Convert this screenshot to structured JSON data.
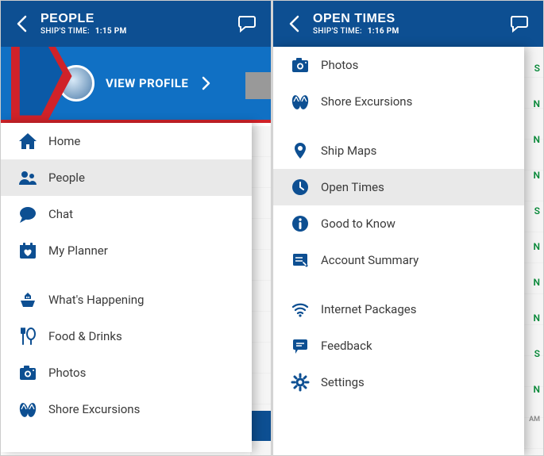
{
  "colors": {
    "brand_blue": "#0d4f92",
    "accent_red": "#d02229",
    "bg_selected": "#e9e9e9"
  },
  "left": {
    "header": {
      "title": "PEOPLE",
      "time_label": "SHIP'S TIME:",
      "time": "1:15 PM"
    },
    "profile": {
      "label": "VIEW PROFILE"
    },
    "menu": [
      {
        "key": "home",
        "label": "Home",
        "icon": "home-icon"
      },
      {
        "key": "people",
        "label": "People",
        "icon": "people-icon",
        "selected": true
      },
      {
        "key": "chat",
        "label": "Chat",
        "icon": "chat-bubble-icon"
      },
      {
        "key": "planner",
        "label": "My Planner",
        "icon": "calendar-heart-icon"
      },
      {
        "sep": true
      },
      {
        "key": "happening",
        "label": "What's Happening",
        "icon": "ship-icon"
      },
      {
        "key": "food",
        "label": "Food & Drinks",
        "icon": "food-icon"
      },
      {
        "key": "photos",
        "label": "Photos",
        "icon": "camera-icon"
      },
      {
        "key": "shore",
        "label": "Shore Excursions",
        "icon": "flipflops-icon"
      }
    ]
  },
  "right": {
    "header": {
      "title": "OPEN TIMES",
      "time_label": "SHIP'S TIME:",
      "time": "1:16 PM"
    },
    "menu": [
      {
        "key": "photos",
        "label": "Photos",
        "icon": "camera-icon"
      },
      {
        "key": "shore",
        "label": "Shore Excursions",
        "icon": "flipflops-icon"
      },
      {
        "sep": true
      },
      {
        "key": "maps",
        "label": "Ship Maps",
        "icon": "pin-icon"
      },
      {
        "key": "open",
        "label": "Open Times",
        "icon": "clock-icon",
        "selected": true
      },
      {
        "key": "know",
        "label": "Good to Know",
        "icon": "info-icon"
      },
      {
        "key": "account",
        "label": "Account Summary",
        "icon": "receipt-icon"
      },
      {
        "sep": true
      },
      {
        "key": "internet",
        "label": "Internet Packages",
        "icon": "wifi-icon"
      },
      {
        "key": "feedback",
        "label": "Feedback",
        "icon": "feedback-icon"
      },
      {
        "key": "settings",
        "label": "Settings",
        "icon": "gear-icon"
      }
    ]
  }
}
